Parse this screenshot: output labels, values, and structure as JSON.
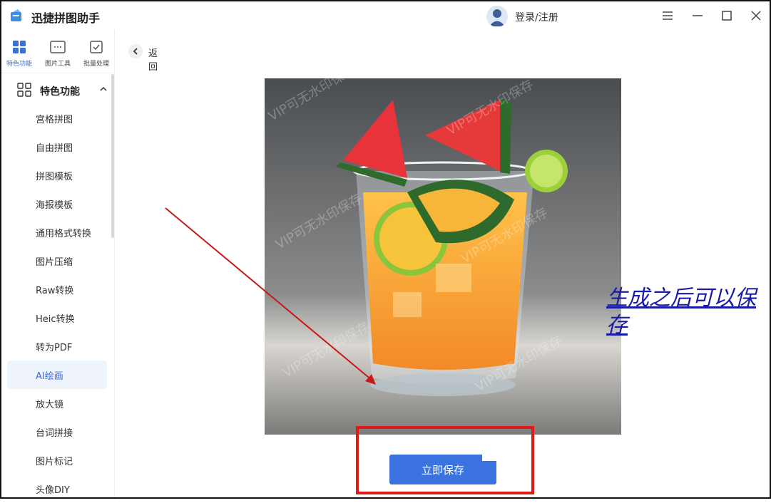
{
  "app": {
    "title": "迅捷拼图助手",
    "login": "登录/注册"
  },
  "topnav": [
    {
      "label": "特色功能",
      "icon": "grid-icon"
    },
    {
      "label": "图片工具",
      "icon": "image-tool-icon"
    },
    {
      "label": "批量处理",
      "icon": "batch-icon"
    }
  ],
  "sidebar": {
    "section": "特色功能",
    "items": [
      {
        "label": "宫格拼图"
      },
      {
        "label": "自由拼图"
      },
      {
        "label": "拼图模板"
      },
      {
        "label": "海报模板"
      },
      {
        "label": "通用格式转换"
      },
      {
        "label": "图片压缩"
      },
      {
        "label": "Raw转换"
      },
      {
        "label": "Heic转换"
      },
      {
        "label": "转为PDF"
      },
      {
        "label": "AI绘画"
      },
      {
        "label": "放大镜"
      },
      {
        "label": "台词拼接"
      },
      {
        "label": "图片标记"
      },
      {
        "label": "头像DIY"
      }
    ],
    "active_item": "AI绘画"
  },
  "main": {
    "back_label": "返回",
    "watermark": "VIP可无水印保存",
    "annotation": "生成之后可以保存",
    "save_label": "立即保存"
  },
  "colors": {
    "accent": "#3a72e0",
    "annotation_red": "#e01818",
    "annotation_text": "#1a1aa8"
  }
}
